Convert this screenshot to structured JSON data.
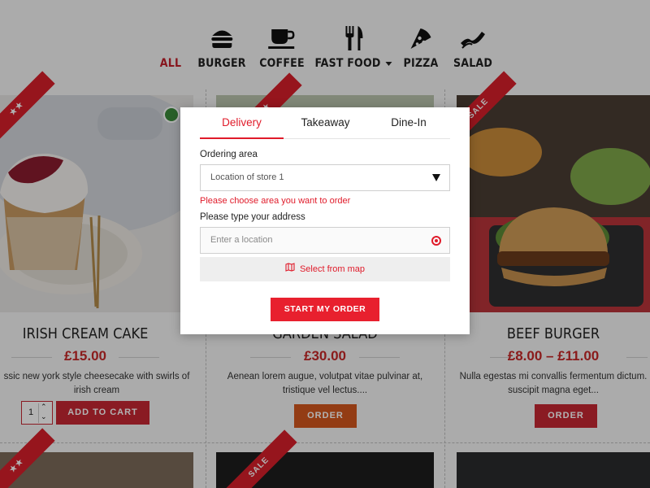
{
  "categories": [
    {
      "label": "ALL",
      "icon": "",
      "active": true
    },
    {
      "label": "BURGER",
      "icon": "burger-icon"
    },
    {
      "label": "COFFEE",
      "icon": "coffee-cup-icon"
    },
    {
      "label": "FAST FOOD",
      "icon": "fork-knife-icon",
      "has_dropdown": true
    },
    {
      "label": "PIZZA",
      "icon": "pizza-slice-icon"
    },
    {
      "label": "SALAD",
      "icon": "bacon-icon"
    }
  ],
  "products": [
    {
      "title": "IRISH CREAM CAKE",
      "price": "£15.00",
      "description": "ssic new york style cheesecake with swirls of irish cream",
      "quantity": "1",
      "action": "ADD TO CART",
      "ribbon": "★★"
    },
    {
      "title": "GARDEN SALAD",
      "price": "£30.00",
      "description": "Aenean lorem augue, volutpat vitae pulvinar at, tristique vel lectus....",
      "action": "ORDER",
      "ribbon": "★★"
    },
    {
      "title": "BEEF BURGER",
      "price": "£8.00 – £11.00",
      "description": "Nulla egestas mi convallis fermentum dictum. suscipit magna eget...",
      "action": "ORDER",
      "ribbon": "SALE"
    }
  ],
  "bottom_ribbons": [
    "★★",
    "SALE"
  ],
  "modal": {
    "tabs": [
      "Delivery",
      "Takeaway",
      "Dine-In"
    ],
    "active_tab": "Delivery",
    "ordering_area_label": "Ordering area",
    "ordering_area_value": "Location of store 1",
    "ordering_area_error": "Please choose area you want to order",
    "address_label": "Please type your address",
    "address_placeholder": "Enter a location",
    "map_button": "Select from map",
    "start_button": "START MY ORDER"
  },
  "colors": {
    "accent": "#e01b2a",
    "price": "#c62828",
    "button": "#c62833",
    "overlay": "rgba(0,0,0,0.3)"
  }
}
